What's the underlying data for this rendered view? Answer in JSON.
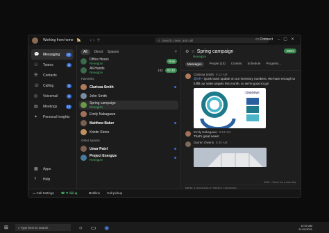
{
  "app": {
    "status": "Working from home",
    "status_emoji": "🏡",
    "search_placeholder": "Search, meet, and call",
    "connect": "Connect"
  },
  "leftnav": {
    "items": [
      {
        "label": "Messaging",
        "badge": "20",
        "icon": "chat-icon"
      },
      {
        "label": "Teams",
        "badge": "6",
        "icon": "teams-icon"
      },
      {
        "label": "Contacts",
        "badge": "",
        "icon": "contacts-icon"
      },
      {
        "label": "Calling",
        "badge": "5",
        "icon": "phone-icon"
      },
      {
        "label": "Voicemail",
        "badge": "6",
        "icon": "voicemail-icon"
      },
      {
        "label": "Meetings",
        "badge": "10",
        "icon": "calendar-icon"
      },
      {
        "label": "Personal Insights",
        "badge": "",
        "icon": "insights-icon"
      }
    ],
    "apps": "Apps",
    "help": "Help"
  },
  "list": {
    "tabs": [
      "All",
      "Direct",
      "Spaces"
    ],
    "office_hours": {
      "name": "Office Hours",
      "team": "Renegize",
      "pill": "Now"
    },
    "allhands": {
      "name": "All-Hands",
      "team": "Renegize",
      "count": "132",
      "pill": "02:40"
    },
    "favorites_label": "Favorites",
    "favorites": [
      {
        "name": "Clarissa Smith",
        "bold": true,
        "color": "#b07a5a"
      },
      {
        "name": "John Smith",
        "bold": false,
        "color": "#7a8aa0"
      },
      {
        "name": "Spring campaign",
        "team": "Renegize",
        "bold": false,
        "color": "#6a9a4a"
      },
      {
        "name": "Emily Nakagawa",
        "bold": false,
        "color": "#a0705a"
      },
      {
        "name": "Matthew Baker",
        "bold": true,
        "color": "#7a6050"
      },
      {
        "name": "Kristin Stone",
        "bold": false,
        "color": "#c09060"
      }
    ],
    "other_label": "Other spaces",
    "others": [
      {
        "name": "Umar Patel",
        "bold": true,
        "color": "#806050"
      },
      {
        "name": "Project Energize",
        "team": "Renegize",
        "bold": true,
        "color": "#4a7a9a"
      }
    ]
  },
  "main": {
    "title": "Spring campaign",
    "team": "Renegize",
    "meet": "Meet",
    "tabs": [
      "Messages",
      "People (10)",
      "Content",
      "Schedule",
      "Progress..."
    ],
    "messages": [
      {
        "who": "Clarissa Smith",
        "time": "8:12 AM",
        "mention": "@All",
        "text": " – Quick team update on our inventory numbers. We have enough to fulfill our sales targets this month, so we're good to go!"
      },
      {
        "who": "Emily Nakagawa",
        "time": "8:13 AM",
        "text": "That's great news!"
      },
      {
        "who": "Darren Owens",
        "time": "8:30 AM",
        "text": ""
      }
    ],
    "image_label": "OneDrive",
    "compose_placeholder": "Write a message to Spring campaign",
    "compose_hint": "Shift + Enter for a new line"
  },
  "footer": {
    "call_settings": "Call Settings",
    "multiline": "Multiline",
    "call_pickup": "Call pickup"
  },
  "taskbar": {
    "search": "Type here to search",
    "time": "12:00 AM",
    "date": "21/11/2021"
  }
}
